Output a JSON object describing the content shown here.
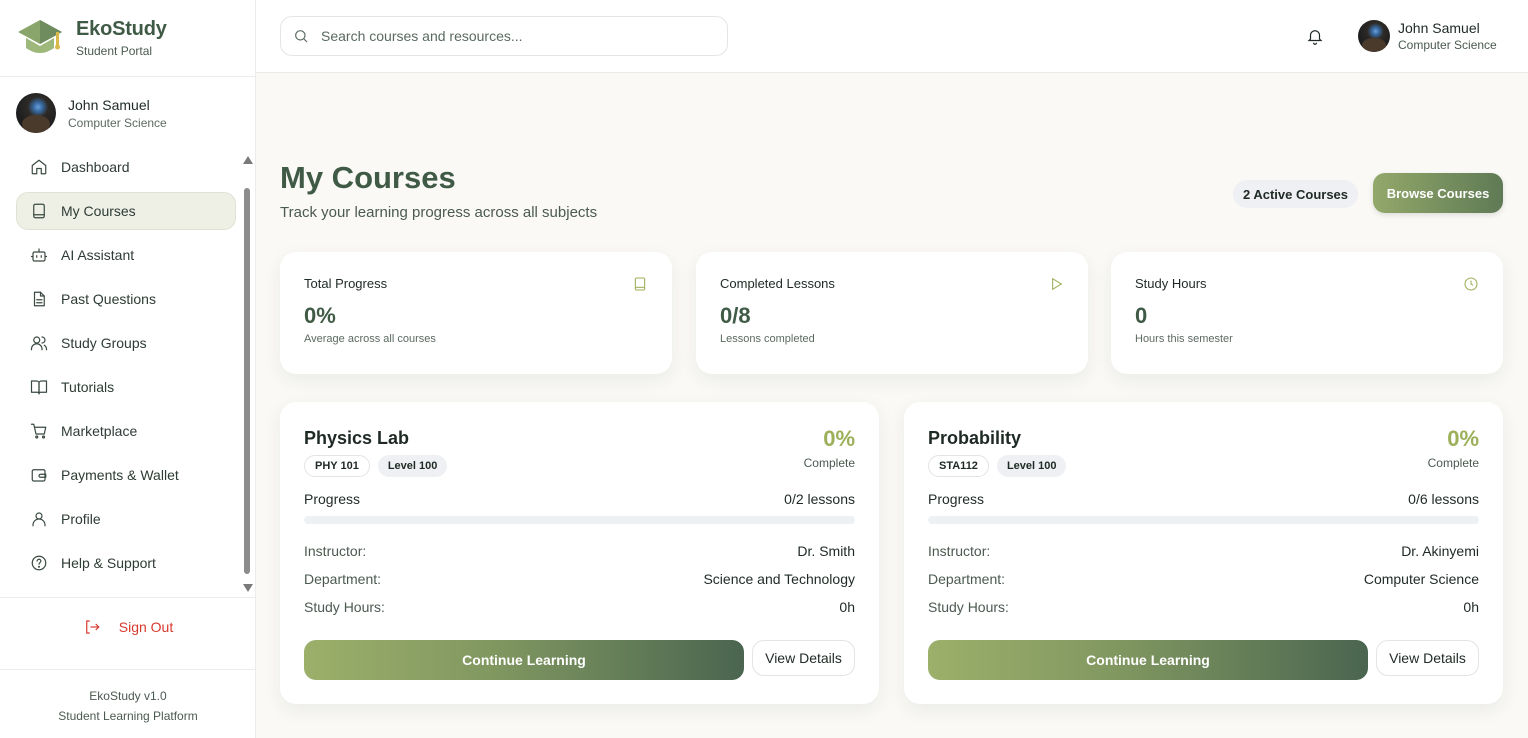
{
  "brand": {
    "name": "EkoStudy",
    "subtitle": "Student Portal"
  },
  "user": {
    "name": "John Samuel",
    "department": "Computer Science"
  },
  "sidebar": {
    "items": [
      {
        "label": "Dashboard",
        "icon": "home-icon"
      },
      {
        "label": "My Courses",
        "icon": "book-icon",
        "active": true
      },
      {
        "label": "AI Assistant",
        "icon": "bot-icon"
      },
      {
        "label": "Past Questions",
        "icon": "file-text-icon"
      },
      {
        "label": "Study Groups",
        "icon": "users-icon"
      },
      {
        "label": "Tutorials",
        "icon": "open-book-icon"
      },
      {
        "label": "Marketplace",
        "icon": "cart-icon"
      },
      {
        "label": "Payments & Wallet",
        "icon": "wallet-icon"
      },
      {
        "label": "Profile",
        "icon": "user-icon"
      },
      {
        "label": "Help & Support",
        "icon": "help-circle-icon"
      }
    ],
    "sign_out": "Sign Out",
    "footer_version": "EkoStudy v1.0",
    "footer_tagline": "Student Learning Platform"
  },
  "search": {
    "placeholder": "Search courses and resources..."
  },
  "header": {
    "title": "My Courses",
    "subtitle": "Track your learning progress across all subjects",
    "active_courses": "2 Active Courses",
    "browse_label": "Browse Courses"
  },
  "stats": [
    {
      "label": "Total Progress",
      "value": "0%",
      "desc": "Average across all courses",
      "icon": "book-icon"
    },
    {
      "label": "Completed Lessons",
      "value": "0/8",
      "desc": "Lessons completed",
      "icon": "play-icon"
    },
    {
      "label": "Study Hours",
      "value": "0",
      "desc": "Hours this semester",
      "icon": "clock-icon"
    }
  ],
  "courses": [
    {
      "title": "Physics Lab",
      "code": "PHY 101",
      "level": "Level 100",
      "percent": "0%",
      "percent_label": "Complete",
      "progress_fraction": 0,
      "progress_label": "Progress",
      "lessons": "0/2 lessons",
      "instructor_label": "Instructor:",
      "instructor": "Dr. Smith",
      "department_label": "Department:",
      "department": "Science and Technology",
      "hours_label": "Study Hours:",
      "hours": "0h",
      "continue_label": "Continue Learning",
      "details_label": "View Details"
    },
    {
      "title": "Probability",
      "code": "STA112",
      "level": "Level 100",
      "percent": "0%",
      "percent_label": "Complete",
      "progress_fraction": 0,
      "progress_label": "Progress",
      "lessons": "0/6 lessons",
      "instructor_label": "Instructor:",
      "instructor": "Dr. Akinyemi",
      "department_label": "Department:",
      "department": "Computer Science",
      "hours_label": "Study Hours:",
      "hours": "0h",
      "continue_label": "Continue Learning",
      "details_label": "View Details"
    }
  ],
  "colors": {
    "brand": "#3f5a45",
    "accent": "#9cb05a",
    "danger": "#d83a2e"
  }
}
